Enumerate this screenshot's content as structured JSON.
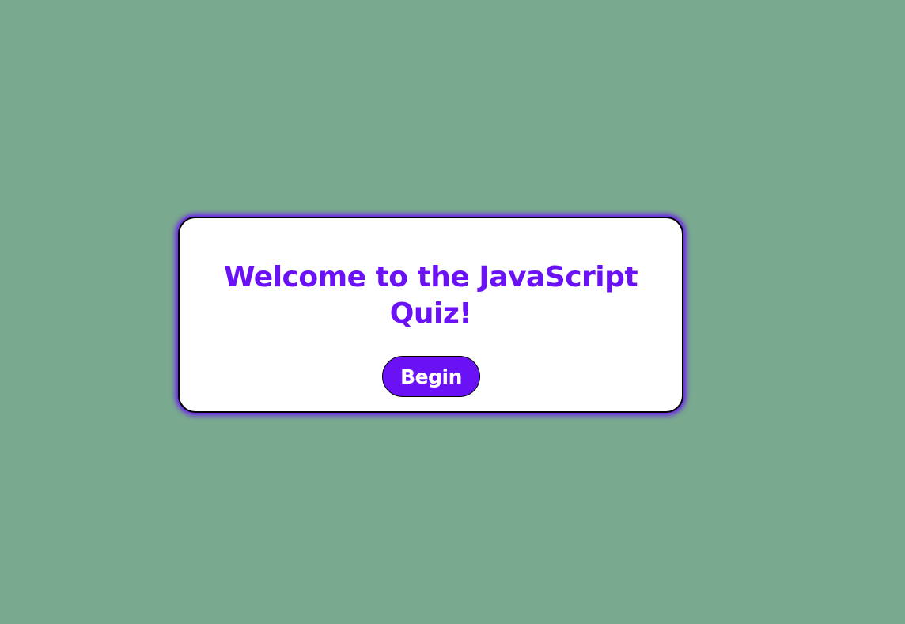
{
  "quiz": {
    "title": "Welcome to the JavaScript Quiz!",
    "begin_label": "Begin"
  },
  "colors": {
    "background": "#79a98e",
    "accent": "#6a11f5",
    "card": "#ffffff"
  }
}
